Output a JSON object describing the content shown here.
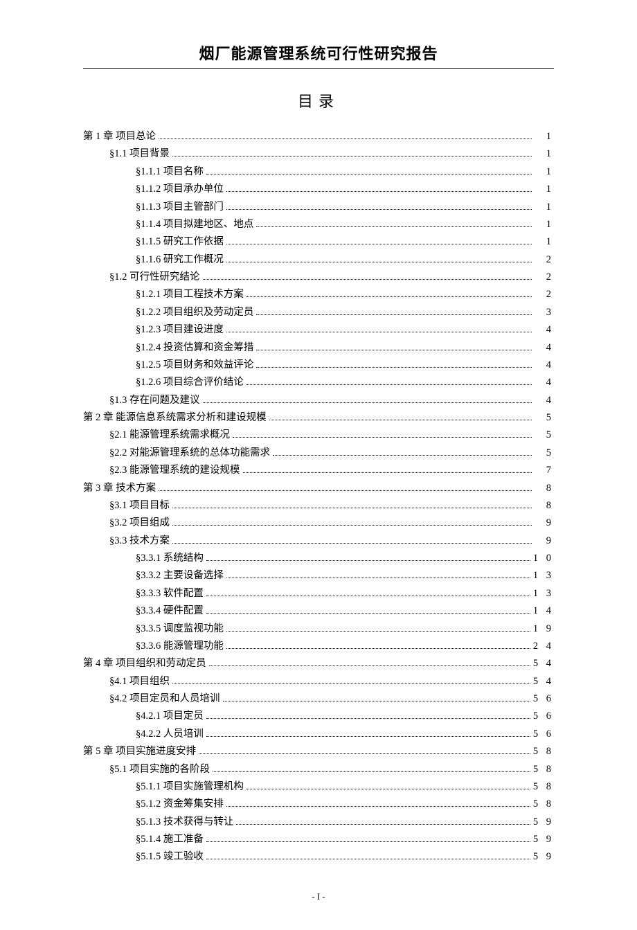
{
  "doc_title": "烟厂能源管理系统可行性研究报告",
  "toc_heading": "目录",
  "footer": "- I -",
  "toc": [
    {
      "level": 0,
      "label": "第 1 章  项目总论",
      "page": "1"
    },
    {
      "level": 1,
      "label": "§1.1  项目背景",
      "page": "1"
    },
    {
      "level": 2,
      "label": "§1.1.1  项目名称",
      "page": "1"
    },
    {
      "level": 2,
      "label": "§1.1.2  项目承办单位",
      "page": "1"
    },
    {
      "level": 2,
      "label": "§1.1.3  项目主管部门",
      "page": "1"
    },
    {
      "level": 2,
      "label": "§1.1.4  项目拟建地区、地点",
      "page": "1"
    },
    {
      "level": 2,
      "label": "§1.1.5  研究工作依据",
      "page": "1"
    },
    {
      "level": 2,
      "label": "§1.1.6  研究工作概况",
      "page": "2"
    },
    {
      "level": 1,
      "label": "§1.2  可行性研究结论",
      "page": "2"
    },
    {
      "level": 2,
      "label": "§1.2.1  项目工程技术方案",
      "page": "2"
    },
    {
      "level": 2,
      "label": "§1.2.2  项目组织及劳动定员",
      "page": "3"
    },
    {
      "level": 2,
      "label": "§1.2.3  项目建设进度",
      "page": "4"
    },
    {
      "level": 2,
      "label": "§1.2.4  投资估算和资金筹措",
      "page": "4"
    },
    {
      "level": 2,
      "label": "§1.2.5  项目财务和效益评论",
      "page": "4"
    },
    {
      "level": 2,
      "label": "§1.2.6  项目综合评价结论",
      "page": "4"
    },
    {
      "level": 1,
      "label": "§1.3  存在问题及建议",
      "page": "4"
    },
    {
      "level": 0,
      "label": "第 2 章  能源信息系统需求分析和建设规模",
      "page": "5"
    },
    {
      "level": 1,
      "label": "§2.1  能源管理系统需求概况",
      "page": "5"
    },
    {
      "level": 1,
      "label": "§2.2  对能源管理系统的总体功能需求",
      "page": "5"
    },
    {
      "level": 1,
      "label": "§2.3  能源管理系统的建设规模",
      "page": "7"
    },
    {
      "level": 0,
      "label": "第 3 章  技术方案",
      "page": "8"
    },
    {
      "level": 1,
      "label": "§3.1  项目目标",
      "page": "8"
    },
    {
      "level": 1,
      "label": "§3.2  项目组成",
      "page": "9"
    },
    {
      "level": 1,
      "label": "§3.3  技术方案",
      "page": "9"
    },
    {
      "level": 2,
      "label": "§3.3.1  系统结构",
      "page": "1 0"
    },
    {
      "level": 2,
      "label": "§3.3.2  主要设备选择",
      "page": "1 3"
    },
    {
      "level": 2,
      "label": "§3.3.3  软件配置",
      "page": "1 3"
    },
    {
      "level": 2,
      "label": "§3.3.4  硬件配置",
      "page": "1 4"
    },
    {
      "level": 2,
      "label": "§3.3.5  调度监视功能",
      "page": "1 9"
    },
    {
      "level": 2,
      "label": "§3.3.6  能源管理功能",
      "page": "2 4"
    },
    {
      "level": 0,
      "label": "第 4 章  项目组织和劳动定员",
      "page": "5 4"
    },
    {
      "level": 1,
      "label": "§4.1  项目组织",
      "page": "5 4"
    },
    {
      "level": 1,
      "label": "§4.2  项目定员和人员培训",
      "page": "5 6"
    },
    {
      "level": 2,
      "label": "§4.2.1  项目定员",
      "page": "5 6"
    },
    {
      "level": 2,
      "label": "§4.2.2  人员培训",
      "page": "5 6"
    },
    {
      "level": 0,
      "label": "第 5 章  项目实施进度安排",
      "page": "5 8"
    },
    {
      "level": 1,
      "label": "§5.1  项目实施的各阶段",
      "page": "5 8"
    },
    {
      "level": 2,
      "label": "§5.1.1  项目实施管理机构",
      "page": "5 8"
    },
    {
      "level": 2,
      "label": "§5.1.2  资金筹集安排",
      "page": "5 8"
    },
    {
      "level": 2,
      "label": "§5.1.3  技术获得与转让",
      "page": "5 9"
    },
    {
      "level": 2,
      "label": "§5.1.4  施工准备",
      "page": "5 9"
    },
    {
      "level": 2,
      "label": "§5.1.5  竣工验收",
      "page": "5 9"
    }
  ]
}
